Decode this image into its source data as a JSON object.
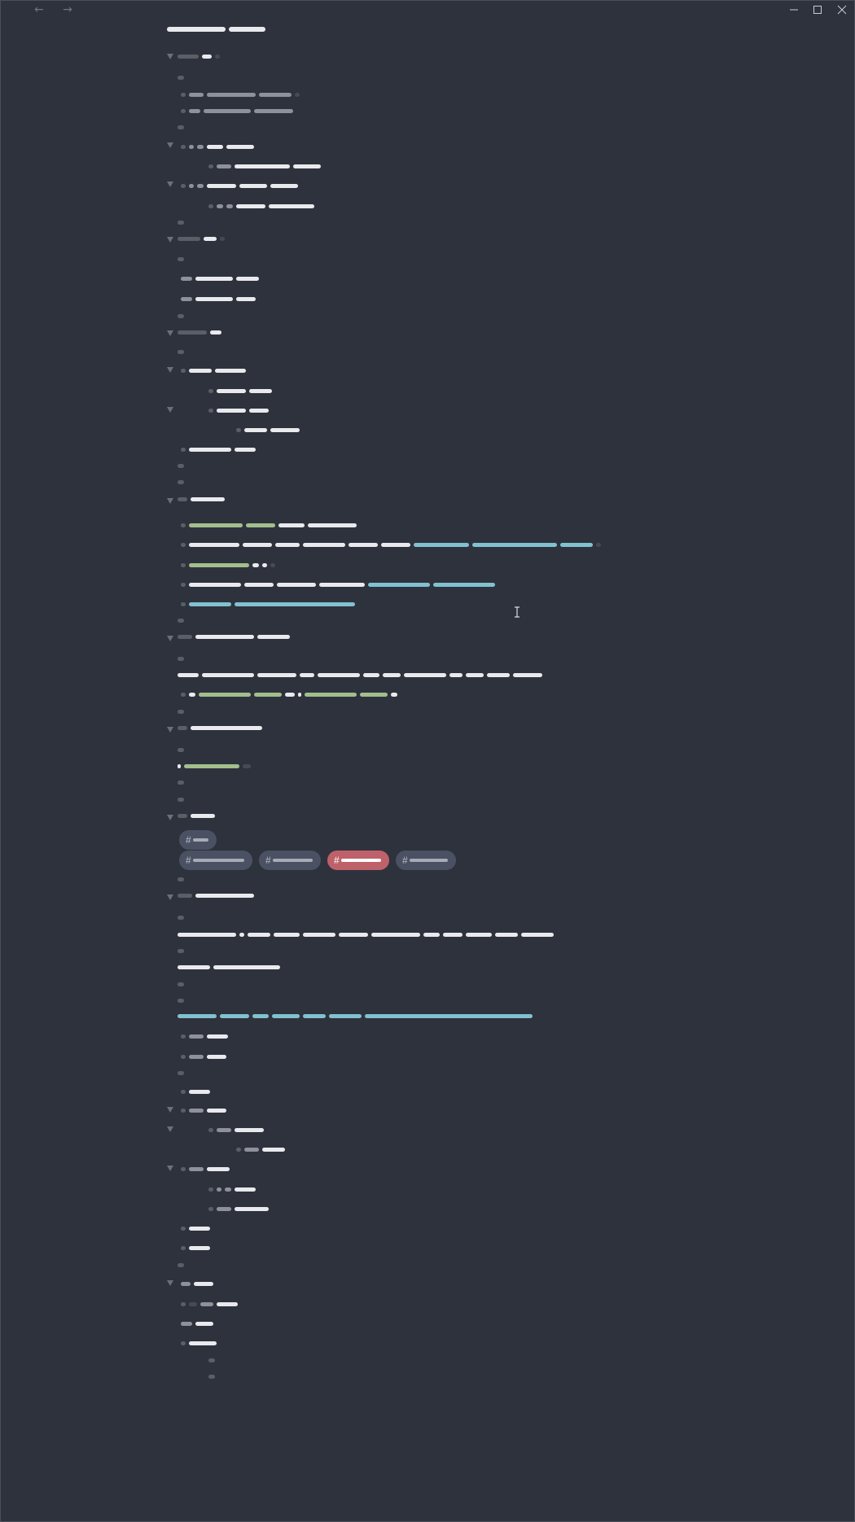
{
  "titlebar": {
    "back_icon": "arrow-left-icon",
    "forward_icon": "arrow-right-icon",
    "minimize_icon": "minimize-icon",
    "maximize_icon": "maximize-icon",
    "close_icon": "close-icon",
    "back_glyph": "←",
    "forward_glyph": "→"
  },
  "tags": {
    "hash": "#"
  },
  "colors": {
    "background": "#2e323d",
    "text": "#e9eaed",
    "muted": "#8e9199",
    "link": "#81c1d0",
    "string": "#a3be8c",
    "tag_bg": "#4a5163",
    "tag_active": "#bf616a"
  }
}
